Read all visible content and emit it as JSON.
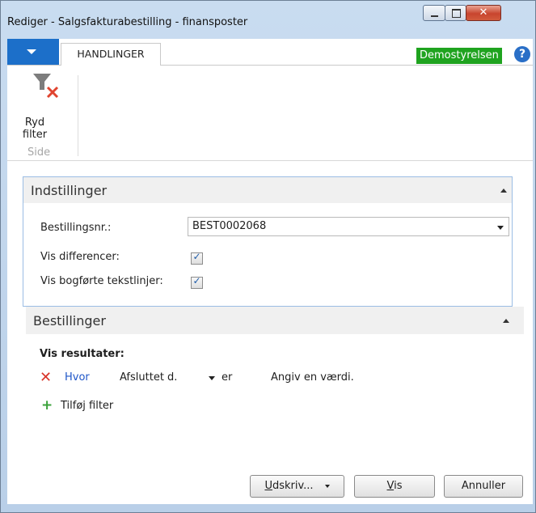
{
  "window": {
    "title": "Rediger - Salgsfakturabestilling - finansposter"
  },
  "ribbon": {
    "tab_label": "HANDLINGER",
    "company": "Demostyrelsen",
    "help_glyph": "?",
    "clear_filter_label_1": "Ryd",
    "clear_filter_label_2": "filter",
    "group_label": "Side"
  },
  "options": {
    "title": "Indstillinger",
    "order_no_label": "Bestillingsnr.:",
    "order_no_value": "BEST0002068",
    "show_diff_label": "Vis differencer:",
    "show_diff_checked": true,
    "show_text_label": "Vis bogførte tekstlinjer:",
    "show_text_checked": true
  },
  "orders": {
    "title": "Bestillinger",
    "results_label": "Vis resultater:",
    "filter": {
      "where": "Hvor",
      "field": "Afsluttet d.",
      "operator": "er",
      "value": "Angiv en værdi."
    },
    "add_filter": "Tilføj filter"
  },
  "buttons": {
    "print_u": "U",
    "print_rest": "dskriv...",
    "vis_u": "V",
    "vis_rest": "is",
    "cancel": "Annuller"
  },
  "colors": {
    "accent": "#1c6fc9",
    "company_bg": "#1fa31f",
    "remove": "#d8352a",
    "add": "#3aa23a"
  }
}
